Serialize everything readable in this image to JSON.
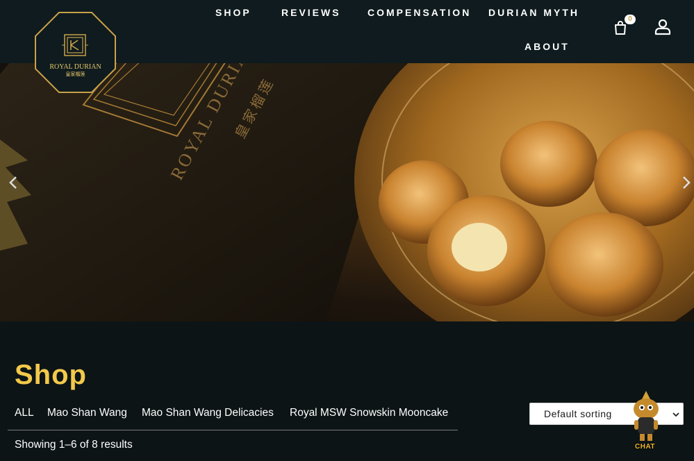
{
  "brand": {
    "name": "ROYAL DURIAN",
    "chinese": "皇家榴莲"
  },
  "nav": {
    "items": [
      "SHOP",
      "REVIEWS",
      "COMPENSATION",
      "DURIAN MYTH",
      "ABOUT"
    ],
    "cart_count": "0"
  },
  "hero": {
    "box_text": "ROYAL DURIAN",
    "box_chinese": "皇家榴莲"
  },
  "shop": {
    "title": "Shop",
    "categories": [
      "ALL",
      "Mao Shan Wang",
      "Mao Shan Wang Delicacies",
      "Royal MSW Snowskin Mooncake"
    ],
    "sort_selected": "Default sorting",
    "results_text": "Showing 1–6 of 8 results"
  },
  "chat": {
    "label": "CHAT"
  },
  "colors": {
    "header_bg": "#0f1b1e",
    "page_bg": "#0c1416",
    "accent_gold": "#f3c94a",
    "logo_gold": "#c9a24a"
  },
  "icons": {
    "cart": "shopping-bag-icon",
    "account": "user-icon",
    "prev": "chevron-left-icon",
    "next": "chevron-right-icon",
    "chat": "mascot-chat-icon"
  }
}
